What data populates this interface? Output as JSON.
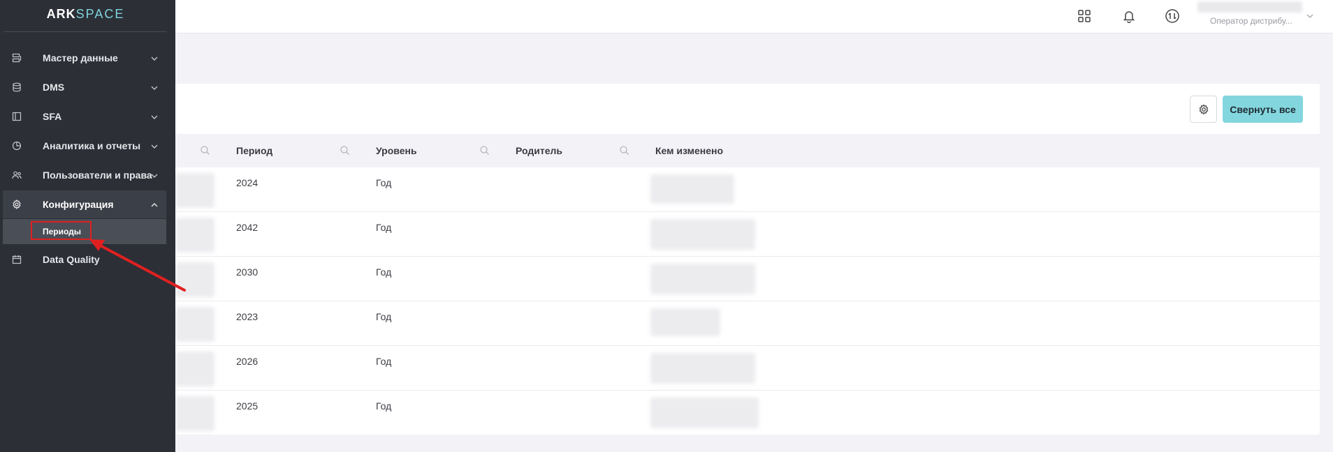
{
  "brand": {
    "logo_main": "ARK",
    "logo_accent": "SPACE"
  },
  "header": {
    "user_role": "Оператор дистрибу...",
    "icons": [
      "apps-grid-icon",
      "bell-icon",
      "sync-icon",
      "chevron-down-icon"
    ]
  },
  "sidebar": {
    "items": [
      {
        "label": "Мастер данные",
        "icon": "master-data-icon",
        "expandable": true
      },
      {
        "label": "DMS",
        "icon": "database-icon",
        "expandable": true
      },
      {
        "label": "SFA",
        "icon": "layout-icon",
        "expandable": true
      },
      {
        "label": "Аналитика и отчеты",
        "icon": "chart-pie-icon",
        "expandable": true
      },
      {
        "label": "Пользователи и права",
        "icon": "users-icon",
        "expandable": true
      },
      {
        "label": "Конфигурация",
        "icon": "gear-icon",
        "expandable": true,
        "expanded": true
      },
      {
        "label": "Data Quality",
        "icon": "calendar-icon",
        "expandable": false
      }
    ],
    "subitems": [
      {
        "label": "Периоды"
      }
    ]
  },
  "toolbar": {
    "collapse_label": "Свернуть все"
  },
  "table": {
    "columns": [
      "Период",
      "Уровень",
      "Родитель",
      "Кем изменено"
    ],
    "rows": [
      {
        "period": "2024",
        "level": "Год",
        "parent": ""
      },
      {
        "period": "2042",
        "level": "Год",
        "parent": ""
      },
      {
        "period": "2030",
        "level": "Год",
        "parent": ""
      },
      {
        "period": "2023",
        "level": "Год",
        "parent": ""
      },
      {
        "period": "2026",
        "level": "Год",
        "parent": ""
      },
      {
        "period": "2025",
        "level": "Год",
        "parent": ""
      }
    ]
  },
  "colors": {
    "sidebar_bg": "#2c2f36",
    "accent": "#83d6de",
    "highlight": "#e02020"
  }
}
